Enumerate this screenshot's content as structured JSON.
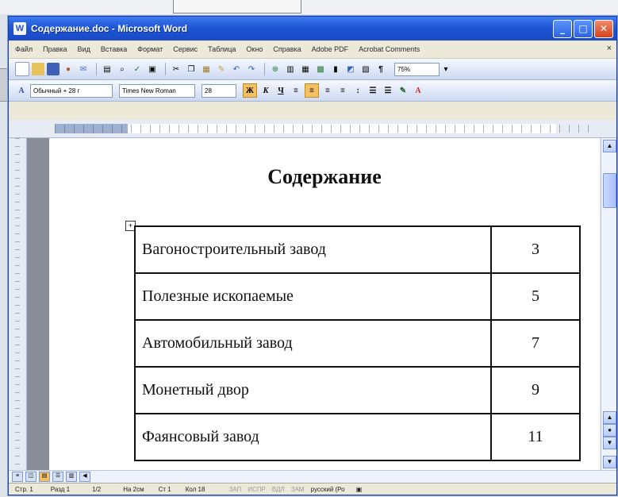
{
  "window": {
    "title": "Содержание.doc - Microsoft Word"
  },
  "menu": [
    "Файл",
    "Правка",
    "Вид",
    "Вставка",
    "Формат",
    "Сервис",
    "Таблица",
    "Окно",
    "Справка",
    "Adobe PDF",
    "Acrobat Comments"
  ],
  "toolbar": {
    "zoom": "75%"
  },
  "format_bar": {
    "style": "Обычный + 28 г",
    "font": "Times New Roman",
    "size": "28"
  },
  "document": {
    "title": "Содержание",
    "toc": [
      {
        "title": "Вагоностроительный завод",
        "page": "3"
      },
      {
        "title": "Полезные ископаемые",
        "page": "5"
      },
      {
        "title": "Автомобильный завод",
        "page": "7"
      },
      {
        "title": "Монетный двор",
        "page": "9"
      },
      {
        "title": "Фаянсовый завод",
        "page": "11"
      }
    ]
  },
  "status": {
    "page": "Стр. 1",
    "section": "Разд 1",
    "pages": "1/2",
    "at": "На 2см",
    "line": "Ст 1",
    "col": "Кол 18",
    "rec": "ЗАП",
    "trk": "ИСПР",
    "ext": "ВДЛ",
    "ovr": "ЗАМ",
    "language": "русский (Ро"
  }
}
